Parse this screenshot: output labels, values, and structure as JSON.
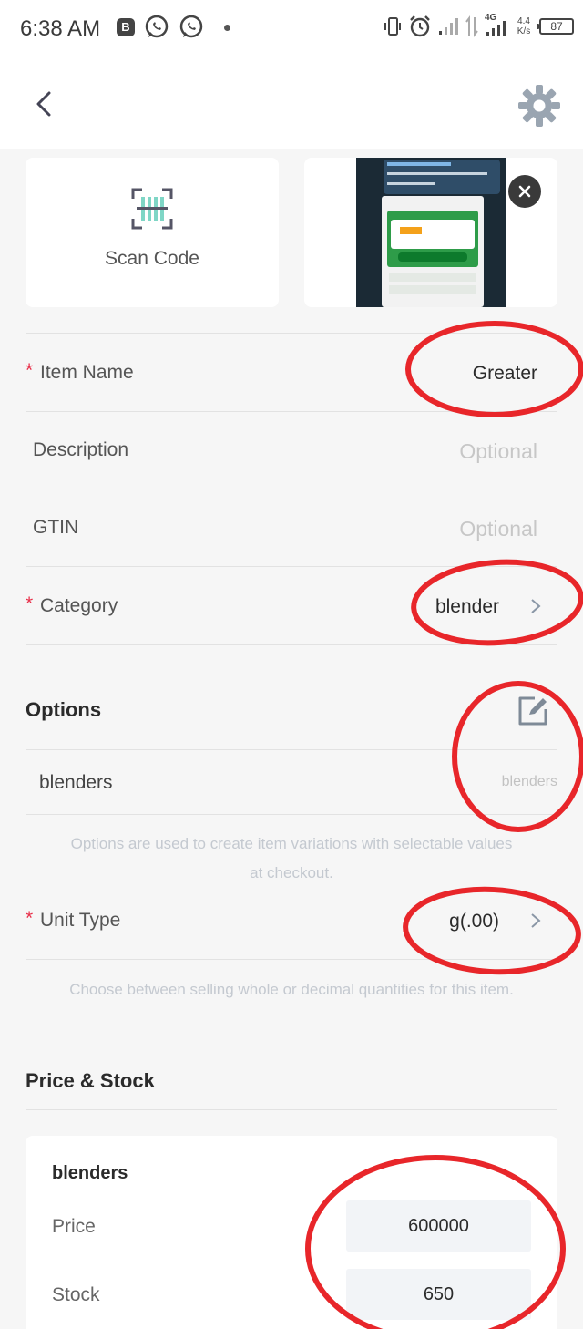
{
  "status_bar": {
    "time": "6:38 AM",
    "net_speed_value": "4.4",
    "net_speed_unit": "K/s",
    "network_type": "4G",
    "battery": "87",
    "left_icons": [
      "b-app-icon",
      "whatsapp-icon",
      "whatsapp-icon",
      "dot-indicator"
    ],
    "right_icons": [
      "vibrate-icon",
      "alarm-icon",
      "signal-icon",
      "data-arrows-icon",
      "signal-4g-icon",
      "battery-icon"
    ]
  },
  "header": {
    "back_icon": "chevron-left-icon",
    "settings_icon": "gear-icon"
  },
  "media": {
    "scan_label": "Scan Code",
    "scan_icon": "barcode-scan-icon",
    "photo_thumbnail": "screenshot-thumbnail",
    "remove_icon": "close-icon"
  },
  "fields": {
    "item_name": {
      "label": "Item Name",
      "value": "Greater",
      "required": true
    },
    "description": {
      "label": "Description",
      "placeholder": "Optional"
    },
    "gtin": {
      "label": "GTIN",
      "placeholder": "Optional"
    },
    "category": {
      "label": "Category",
      "value": "blender",
      "required": true
    }
  },
  "options": {
    "title": "Options",
    "edit_icon": "edit-icon",
    "items": [
      {
        "name": "blenders",
        "values": "blenders"
      }
    ],
    "hint": "Options are used to create item variations with selectable values at checkout."
  },
  "unit_type": {
    "label": "Unit Type",
    "value": "g(.00)",
    "required": true,
    "hint": "Choose between selling whole or decimal quantities for this item."
  },
  "price_stock": {
    "title": "Price & Stock",
    "variants": [
      {
        "name": "blenders",
        "price_label": "Price",
        "price": "600000",
        "stock_label": "Stock",
        "stock": "650"
      }
    ]
  },
  "annotations": {
    "color": "#e8262a",
    "shape": "hand-drawn-ellipse"
  }
}
